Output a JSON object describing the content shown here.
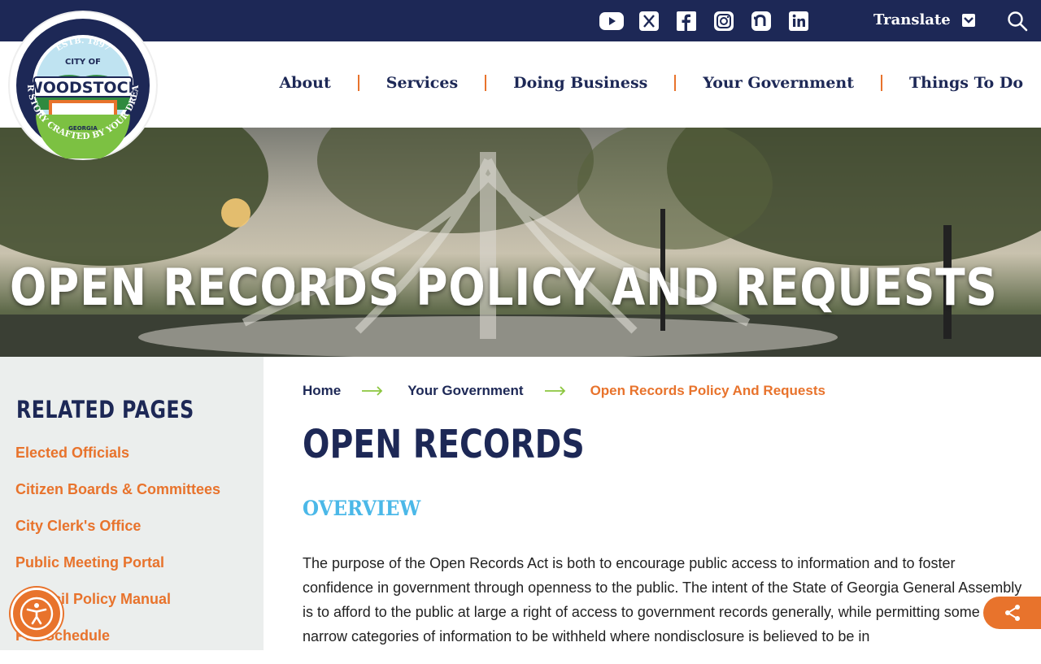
{
  "header": {
    "social_icons": [
      "youtube-icon",
      "x-icon",
      "facebook-icon",
      "instagram-icon",
      "nextdoor-icon",
      "linkedin-icon"
    ],
    "translate_label": "Translate"
  },
  "logo": {
    "estb": "ESTB. 1897",
    "city_of": "CITY OF",
    "name": "WOODSTOCK",
    "state": "GEORGIA",
    "tagline": "OUR STORY CRAFTED BY YOUR DREAMS"
  },
  "nav": {
    "items": [
      "About",
      "Services",
      "Doing Business",
      "Your Government",
      "Things To Do"
    ]
  },
  "hero": {
    "title": "OPEN RECORDS POLICY AND REQUESTS"
  },
  "sidebar": {
    "heading": "RELATED PAGES",
    "links": [
      "Elected Officials",
      "Citizen Boards & Committees",
      "City Clerk's Office",
      "Public Meeting Portal",
      "Council Policy Manual",
      "Fee Schedule"
    ]
  },
  "breadcrumb": {
    "items": [
      "Home",
      "Your Government",
      "Open Records Policy And Requests"
    ]
  },
  "main": {
    "title": "OPEN RECORDS",
    "section_heading": "OVERVIEW",
    "paragraph": "The purpose of the Open Records Act is both to encourage public access to information and to foster confidence in government through openness to the public. The intent of the State of Georgia General Assembly is to afford to the public at large a right of access to government records generally, while permitting some narrow categories of information to be withheld where nondisclosure is believed to be in"
  },
  "colors": {
    "navy": "#1d2856",
    "orange": "#e8732c",
    "sky": "#4bb8e8",
    "sidebar_bg": "#ebeeed",
    "arrow_green": "#8cc63f"
  }
}
